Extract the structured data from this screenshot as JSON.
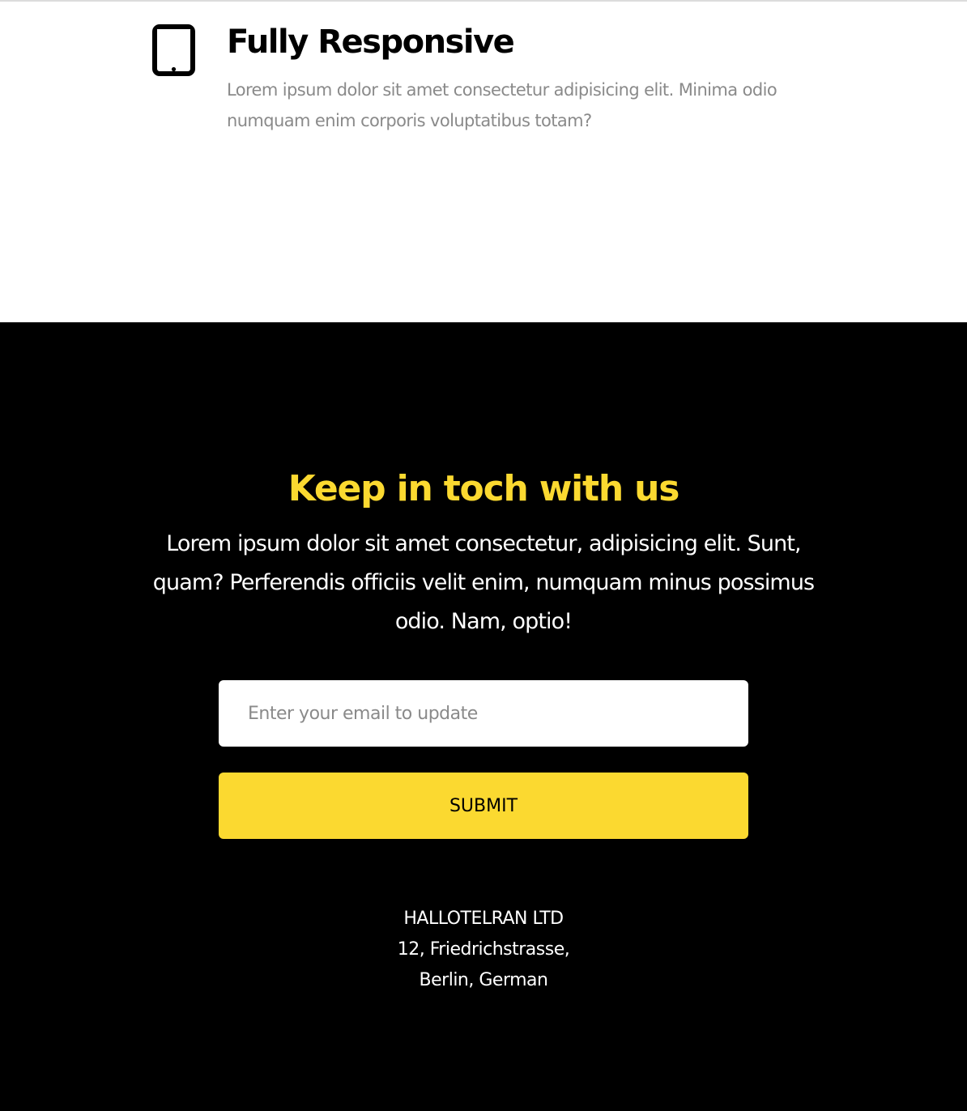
{
  "feature": {
    "icon": "tablet-icon",
    "title": "Fully Responsive",
    "description": "Lorem ipsum dolor sit amet consectetur adipisicing elit. Minima odio numquam enim corporis voluptatibus totam?"
  },
  "contact": {
    "heading": "Keep in toch with us",
    "text": "Lorem ipsum dolor sit amet consectetur, adipisicing elit. Sunt, quam? Perferendis officiis velit enim, numquam minus possimus odio. Nam, optio!",
    "email_placeholder": "Enter your email to update",
    "submit_label": "SUBMIT",
    "accent_color": "#fbd930"
  },
  "address": {
    "company": "HALLOTELRAN LTD",
    "street": "12, Friedrichstrasse,",
    "city": "Berlin, German"
  }
}
